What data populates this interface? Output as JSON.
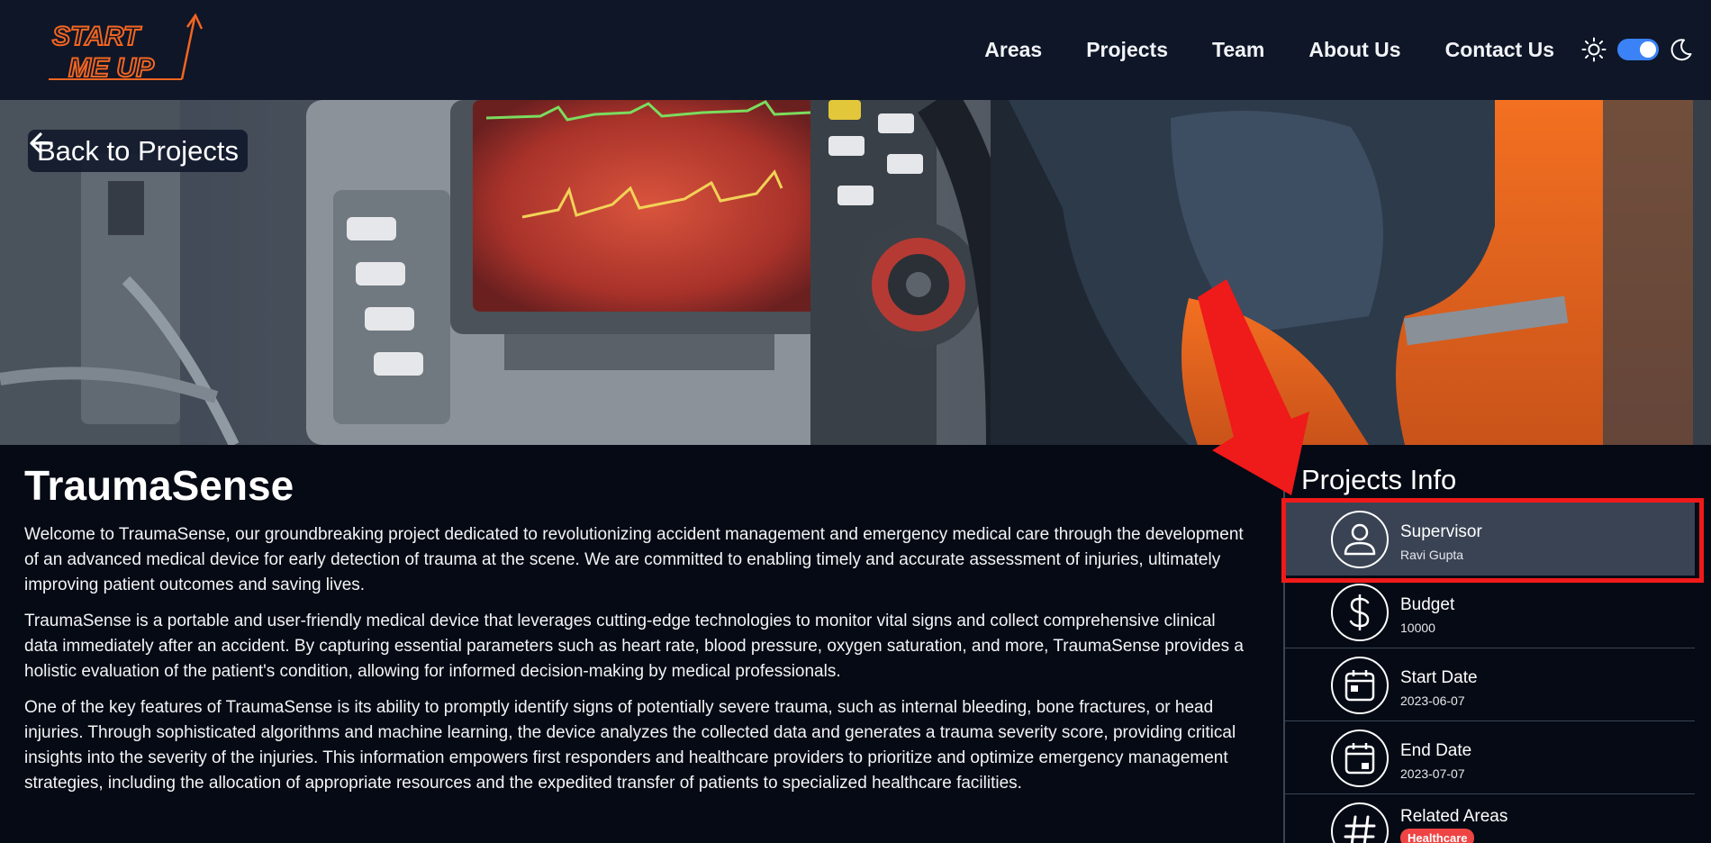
{
  "brand": {
    "logo_line1": "START",
    "logo_line2": "ME UP",
    "accent": "#f26522"
  },
  "nav": {
    "links": [
      {
        "label": "Areas"
      },
      {
        "label": "Projects"
      },
      {
        "label": "Team"
      },
      {
        "label": "About Us"
      },
      {
        "label": "Contact Us"
      }
    ],
    "theme": {
      "sun_icon": "sun-icon",
      "moon_icon": "moon-icon",
      "dark_mode": true
    }
  },
  "hero": {
    "back_label": "Back to Projects",
    "back_icon": "arrow-left-icon"
  },
  "project": {
    "title": "TraumaSense",
    "paragraphs": [
      "Welcome to TraumaSense, our groundbreaking project dedicated to revolutionizing accident management and emergency medical care through the development of an advanced medical device for early detection of trauma at the scene. We are committed to enabling timely and accurate assessment of injuries, ultimately improving patient outcomes and saving lives.",
      "TraumaSense is a portable and user-friendly medical device that leverages cutting-edge technologies to monitor vital signs and collect comprehensive clinical data immediately after an accident. By capturing essential parameters such as heart rate, blood pressure, oxygen saturation, and more, TraumaSense provides a holistic evaluation of the patient's condition, allowing for informed decision-making by medical professionals.",
      "One of the key features of TraumaSense is its ability to promptly identify signs of potentially severe trauma, such as internal bleeding, bone fractures, or head injuries. Through sophisticated algorithms and machine learning, the device analyzes the collected data and generates a trauma severity score, providing critical insights into the severity of the injuries. This information empowers first responders and healthcare providers to prioritize and optimize emergency management strategies, including the allocation of appropriate resources and the expedited transfer of patients to specialized healthcare facilities."
    ]
  },
  "sidebar": {
    "title": "Projects Info",
    "items": [
      {
        "label": "Supervisor",
        "value": "Ravi Gupta",
        "icon": "user-icon"
      },
      {
        "label": "Budget",
        "value": "10000",
        "icon": "dollar-icon"
      },
      {
        "label": "Start Date",
        "value": "2023-06-07",
        "icon": "calendar-icon"
      },
      {
        "label": "End Date",
        "value": "2023-07-07",
        "icon": "calendar-icon"
      },
      {
        "label": "Related Areas",
        "value": "Healthcare",
        "icon": "hash-icon"
      }
    ]
  },
  "colors": {
    "navbar": "#0e1627",
    "background": "#050a14",
    "toggle": "#3b82f6",
    "highlight": "#ef1a1a",
    "badge": "#ef4444"
  }
}
